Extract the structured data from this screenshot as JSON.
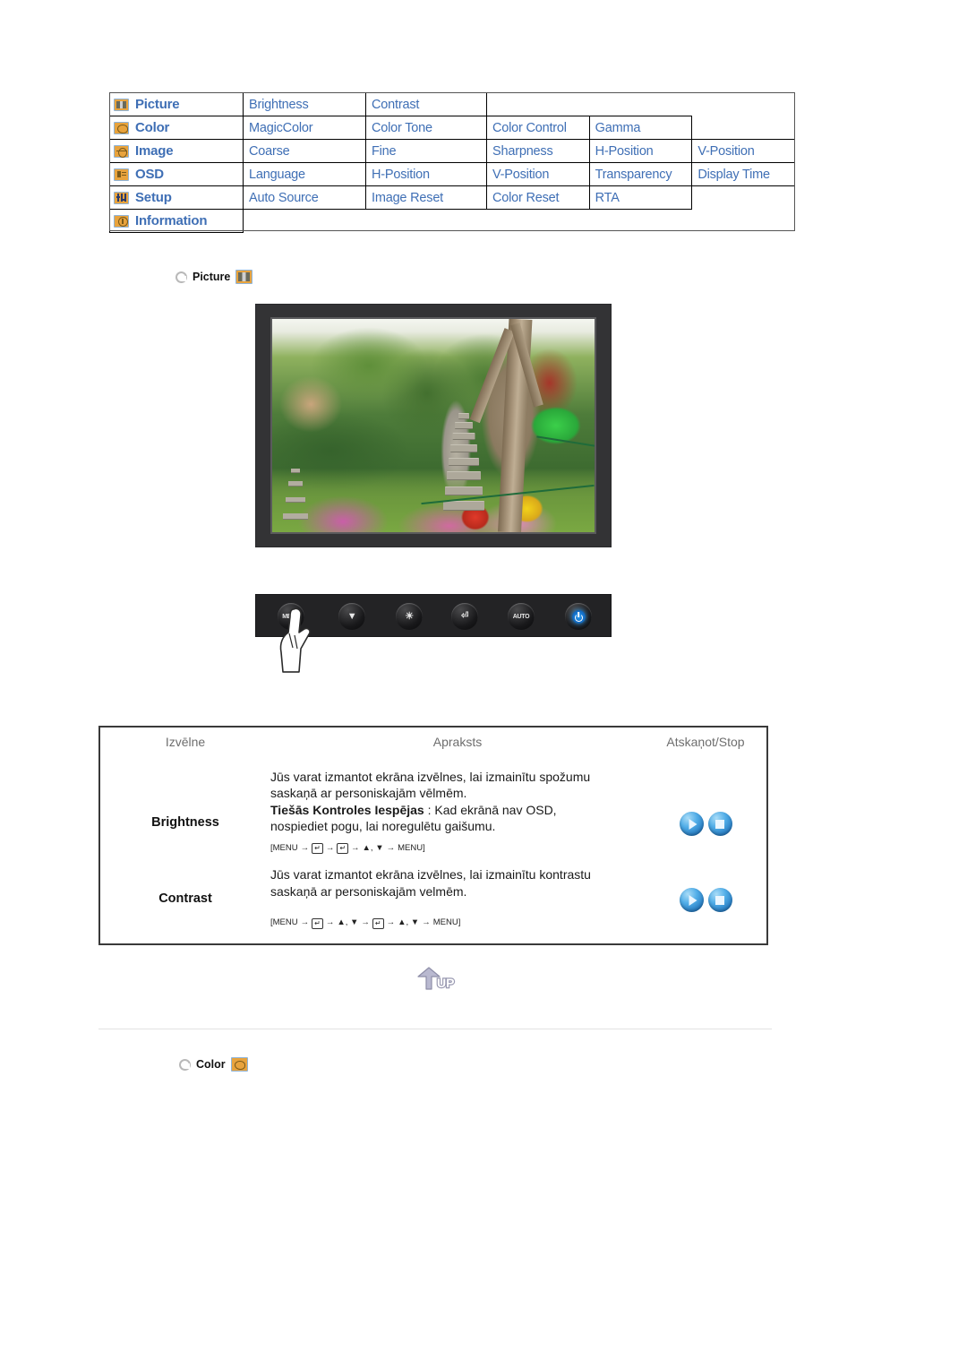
{
  "menu_map": {
    "rows": [
      {
        "category": "Picture",
        "icon": "picture-icon",
        "items": [
          "Brightness",
          "Contrast"
        ]
      },
      {
        "category": "Color",
        "icon": "color-icon",
        "items": [
          "MagicColor",
          "Color Tone",
          "Color Control",
          "Gamma"
        ]
      },
      {
        "category": "Image",
        "icon": "image-icon",
        "items": [
          "Coarse",
          "Fine",
          "Sharpness",
          "H-Position",
          "V-Position"
        ]
      },
      {
        "category": "OSD",
        "icon": "osd-icon",
        "items": [
          "Language",
          "H-Position",
          "V-Position",
          "Transparency",
          "Display Time"
        ]
      },
      {
        "category": "Setup",
        "icon": "setup-icon",
        "items": [
          "Auto Source",
          "Image Reset",
          "Color Reset",
          "RTA"
        ]
      },
      {
        "category": "Information",
        "icon": "information-icon",
        "items": []
      }
    ],
    "label_color": "#3f6fb5",
    "icon_color": "#e8a33d"
  },
  "sections": {
    "picture": {
      "label": "Picture",
      "icon": "picture-icon"
    },
    "color": {
      "label": "Color",
      "icon": "color-icon"
    }
  },
  "monitor": {
    "alt": "monitor displaying garden scene with stone pagoda and lanterns"
  },
  "buttons": [
    {
      "name": "menu-button",
      "label": "MENU"
    },
    {
      "name": "down-button",
      "label": "▼"
    },
    {
      "name": "brightness-button",
      "label": "☀"
    },
    {
      "name": "enter-button",
      "label": "⏎"
    },
    {
      "name": "auto-button",
      "label": "AUTO"
    },
    {
      "name": "power-button",
      "label": ""
    }
  ],
  "desc_table": {
    "headers": {
      "menu": "Izvēlne",
      "description": "Apraksts",
      "play": "Atskaņot/Stop"
    },
    "rows": [
      {
        "menu": "Brightness",
        "line1": "Jūs varat izmantot ekrāna izvēlnes, lai izmainītu spožumu",
        "line2": "saskaņā ar personiskajām vēlmēm.",
        "bold_lead": "Tiešās Kontroles Iespējas",
        "line3_rest": " : Kad ekrānā nav OSD,",
        "line4": "nospiediet pogu, lai noregulētu gaišumu.",
        "sequence": [
          "[MENU",
          "→",
          "KEY",
          "→",
          "KEY",
          "→",
          "▲, ▼",
          "→",
          "MENU]"
        ]
      },
      {
        "menu": "Contrast",
        "line1": "Jūs varat izmantot ekrāna izvēlnes, lai izmainītu kontrastu",
        "line2": "saskaņā ar personiskajām velmēm.",
        "bold_lead": "",
        "line3_rest": "",
        "line4": "",
        "sequence": [
          "[MENU",
          "→",
          "KEY",
          "→",
          "▲, ▼",
          "→",
          "KEY",
          "→",
          "▲, ▼",
          "→",
          "MENU]"
        ]
      }
    ],
    "play_icons": [
      "play-icon",
      "stop-icon"
    ]
  },
  "up_button": {
    "label": "UP",
    "name": "up-button"
  }
}
